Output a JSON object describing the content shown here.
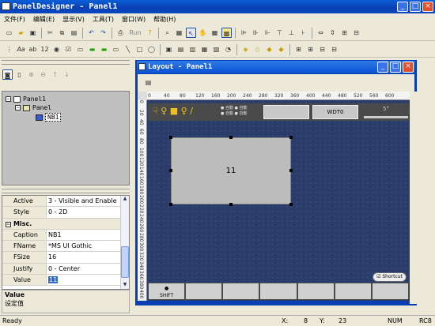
{
  "window": {
    "title": "PanelDesigner - Panel1",
    "controls": [
      "_",
      "□",
      "×"
    ]
  },
  "menu": [
    "文件(F)",
    "编辑(E)",
    "显示(V)",
    "工具(T)",
    "窗口(W)",
    "帮助(H)"
  ],
  "toolbar": {
    "run_label": "Run"
  },
  "tree": {
    "items": [
      "Panel1",
      "Panel",
      "NB1"
    ]
  },
  "properties": {
    "rows": [
      {
        "k": "Active",
        "v": "3 - Visible and Enable"
      },
      {
        "k": "Style",
        "v": "0 - 2D"
      },
      {
        "k": "Misc.",
        "v": ""
      },
      {
        "k": "Caption",
        "v": "NB1"
      },
      {
        "k": "FName",
        "v": "*MS UI Gothic"
      },
      {
        "k": "FSize",
        "v": "16"
      },
      {
        "k": "Justify",
        "v": "0 - Center"
      },
      {
        "k": "Value",
        "v": "11"
      }
    ],
    "desc_title": "Value",
    "desc_text": "设定值"
  },
  "layout": {
    "title": "Layout - Panel1",
    "ruler_h": [
      "0",
      "40",
      "80",
      "120",
      "160",
      "200",
      "240",
      "280",
      "320",
      "360",
      "400",
      "440",
      "480",
      "520",
      "560",
      "600"
    ],
    "ruler_v": [
      "0",
      "20",
      "40",
      "60",
      "80",
      "100",
      "120",
      "140",
      "160",
      "180",
      "200",
      "220",
      "240",
      "260",
      "280",
      "300",
      "320",
      "340",
      "360",
      "380",
      "400"
    ],
    "widget_value": "11",
    "mini_icons": "☟ ♀ ■ ♀ /",
    "radio_labels": [
      "自動",
      "自動",
      "自動",
      "自動"
    ],
    "wd_label": "WDT0",
    "deg_label": "5°",
    "shortcut_label": "Shortcut",
    "shift_label": "SHIFT"
  },
  "status": {
    "ready": "Ready",
    "x_label": "X:",
    "x_val": "8",
    "y_label": "Y:",
    "y_val": "23",
    "mode": "NUM",
    "rc": "RC8"
  }
}
